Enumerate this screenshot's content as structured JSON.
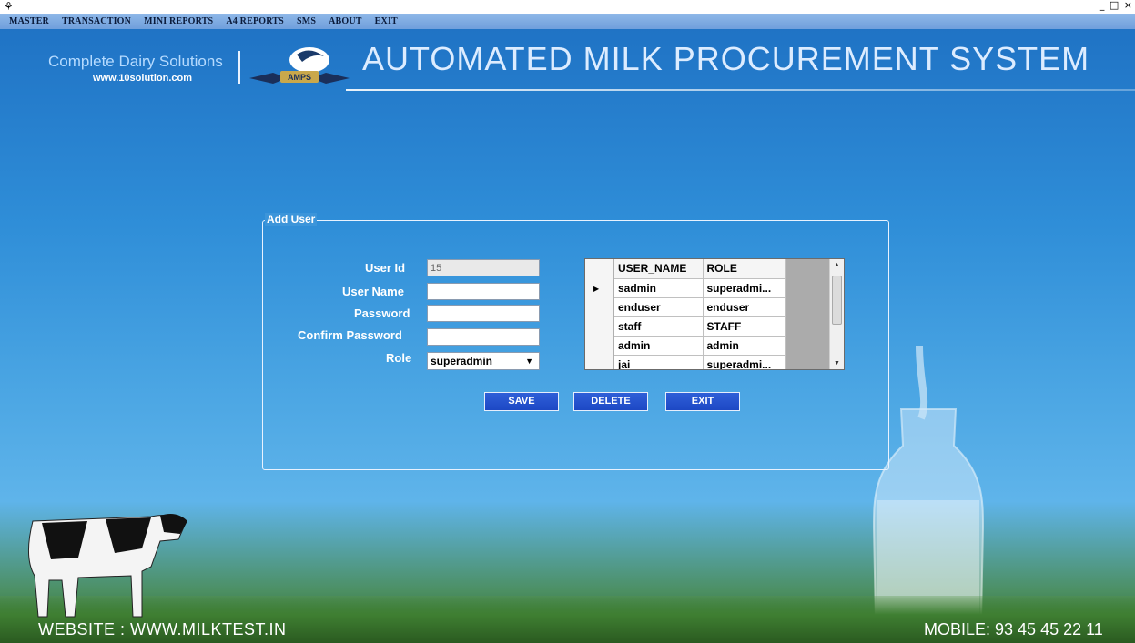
{
  "titlebar": {
    "window_controls": "_ □ ×"
  },
  "menu": [
    "MASTER",
    "TRANSACTION",
    "MINI REPORTS",
    "A4 REPORTS",
    "SMS",
    "ABOUT",
    "EXIT"
  ],
  "header": {
    "tagline": "Complete Dairy Solutions",
    "url": "www.10solution.com",
    "logo_text": "AMPS",
    "title": "AUTOMATED MILK PROCUREMENT SYSTEM"
  },
  "form": {
    "group_title": "Add User",
    "user_id_label": "User Id",
    "user_id_value": "15",
    "user_name_label": "User Name",
    "user_name_value": "",
    "password_label": "Password",
    "password_value": "",
    "confirm_password_label": "Confirm Password",
    "confirm_password_value": "",
    "role_label": "Role",
    "role_value": "superadmin"
  },
  "grid": {
    "columns": [
      "USER_NAME",
      "ROLE"
    ],
    "rows": [
      [
        "sadmin",
        "superadmi..."
      ],
      [
        "enduser",
        "enduser"
      ],
      [
        "staff",
        "STAFF"
      ],
      [
        "admin",
        "admin"
      ],
      [
        "jai",
        "superadmi..."
      ]
    ]
  },
  "buttons": {
    "save": "SAVE",
    "delete": "DELETE",
    "exit": "EXIT"
  },
  "footer": {
    "website": "WEBSITE : WWW.MILKTEST.IN",
    "mobile": "MOBILE: 93 45 45 22 11"
  },
  "colors": {
    "accent_button": "#1d48c4",
    "menu_bg": "#7fa9e0"
  }
}
